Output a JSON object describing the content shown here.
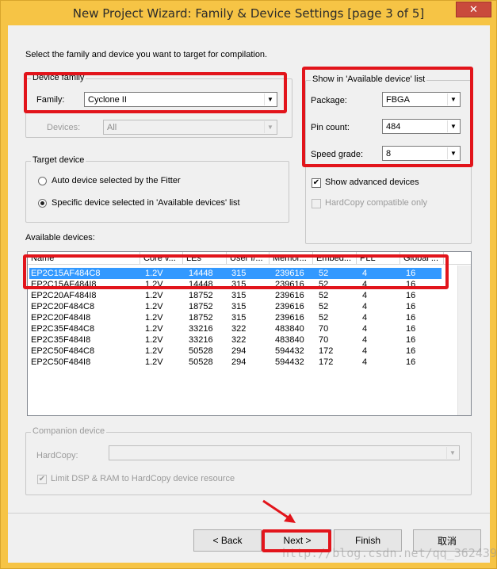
{
  "window": {
    "title": "New Project Wizard: Family & Device Settings [page 3 of 5]",
    "close_icon": "close-icon"
  },
  "instructions": "Select the family and device you want to target for compilation.",
  "device_family": {
    "group_title": "Device family",
    "family_label": "Family:",
    "family_value": "Cyclone II",
    "devices_label": "Devices:",
    "devices_value": "All"
  },
  "target_device": {
    "group_title": "Target device",
    "auto_label": "Auto device selected by the Fitter",
    "specific_label": "Specific device selected in 'Available devices' list",
    "selected": "specific"
  },
  "filters": {
    "group_title": "Show in 'Available device' list",
    "package_label": "Package:",
    "package_value": "FBGA",
    "pin_label": "Pin count:",
    "pin_value": "484",
    "speed_label": "Speed grade:",
    "speed_value": "8",
    "show_advanced_label": "Show advanced devices",
    "show_advanced_checked": true,
    "hardcopy_label": "HardCopy compatible only",
    "hardcopy_checked": false
  },
  "available": {
    "label": "Available devices:",
    "columns": [
      "Name",
      "Core v...",
      "LEs",
      "User I/...",
      "Memor...",
      "Embed...",
      "PLL",
      "Global ..."
    ],
    "rows": [
      [
        "EP2C15AF484C8",
        "1.2V",
        "14448",
        "315",
        "239616",
        "52",
        "4",
        "16"
      ],
      [
        "EP2C15AF484I8",
        "1.2V",
        "14448",
        "315",
        "239616",
        "52",
        "4",
        "16"
      ],
      [
        "EP2C20AF484I8",
        "1.2V",
        "18752",
        "315",
        "239616",
        "52",
        "4",
        "16"
      ],
      [
        "EP2C20F484C8",
        "1.2V",
        "18752",
        "315",
        "239616",
        "52",
        "4",
        "16"
      ],
      [
        "EP2C20F484I8",
        "1.2V",
        "18752",
        "315",
        "239616",
        "52",
        "4",
        "16"
      ],
      [
        "EP2C35F484C8",
        "1.2V",
        "33216",
        "322",
        "483840",
        "70",
        "4",
        "16"
      ],
      [
        "EP2C35F484I8",
        "1.2V",
        "33216",
        "322",
        "483840",
        "70",
        "4",
        "16"
      ],
      [
        "EP2C50F484C8",
        "1.2V",
        "50528",
        "294",
        "594432",
        "172",
        "4",
        "16"
      ],
      [
        "EP2C50F484I8",
        "1.2V",
        "50528",
        "294",
        "594432",
        "172",
        "4",
        "16"
      ]
    ],
    "selected_row": 0
  },
  "companion": {
    "group_title": "Companion device",
    "hardcopy_label": "HardCopy:",
    "hardcopy_value": "",
    "limit_label": "Limit DSP & RAM to HardCopy device resource",
    "limit_checked": true
  },
  "buttons": {
    "back": "< Back",
    "next": "Next >",
    "finish": "Finish",
    "cancel": "取消"
  },
  "watermark": "http://blog.csdn.net/qq_36243942",
  "colors": {
    "highlight": "#e2141b",
    "selection": "#3399ff",
    "title_bar": "#f6c445"
  }
}
